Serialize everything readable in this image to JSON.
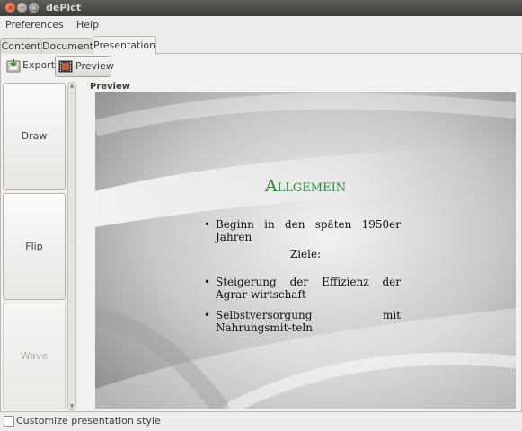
{
  "window": {
    "title": "dePict"
  },
  "menu": [
    "Preferences",
    "Help"
  ],
  "tabs": [
    "Content",
    "Document",
    "Presentation"
  ],
  "toolbar": {
    "export_label": "Export",
    "preview_label": "Preview"
  },
  "effects": [
    {
      "label": "Draw",
      "enabled": true
    },
    {
      "label": "Flip",
      "enabled": true
    },
    {
      "label": "Wave",
      "enabled": false
    }
  ],
  "preview": {
    "heading": "Preview",
    "slide_title": "Allgemein",
    "bullet1": "Beginn in den späten 1950er Jahren",
    "subheading": "Ziele:",
    "bullet2": "Steigerung der Effizienz der Agrar-wirtschaft",
    "bullet3": "Selbstversorgung mit Nahrungsmit-teln"
  },
  "customize": {
    "label": "Customize presentation style",
    "checked": false
  },
  "colors": {
    "title_green": "#2f8a3a",
    "titlebar": "#3d3c38",
    "close_orange": "#df4a16"
  }
}
